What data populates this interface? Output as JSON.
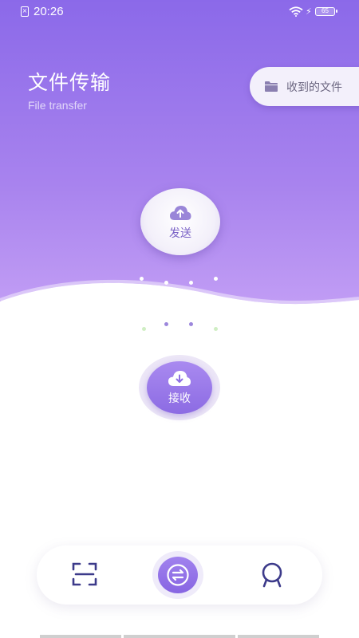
{
  "status_bar": {
    "sim_icon": "sim-card-icon",
    "time": "20:26",
    "wifi_icon": "wifi-icon",
    "charging_icon": "charging-bolt-icon",
    "battery_level": "65"
  },
  "header": {
    "title": "文件传输",
    "subtitle": "File transfer",
    "received_files_label": "收到的文件",
    "received_files_icon": "folder-icon"
  },
  "actions": {
    "send_label": "发送",
    "send_icon": "cloud-upload-icon",
    "receive_label": "接收",
    "receive_icon": "cloud-download-icon"
  },
  "bottom_nav": {
    "items": [
      {
        "icon": "scan-icon",
        "active": false
      },
      {
        "icon": "transfer-icon",
        "active": true
      },
      {
        "icon": "profile-icon",
        "active": false
      }
    ]
  },
  "colors": {
    "accent": "#8b69e9",
    "accent_light": "#c7a3f6",
    "icon_dark": "#3c3a8a"
  }
}
